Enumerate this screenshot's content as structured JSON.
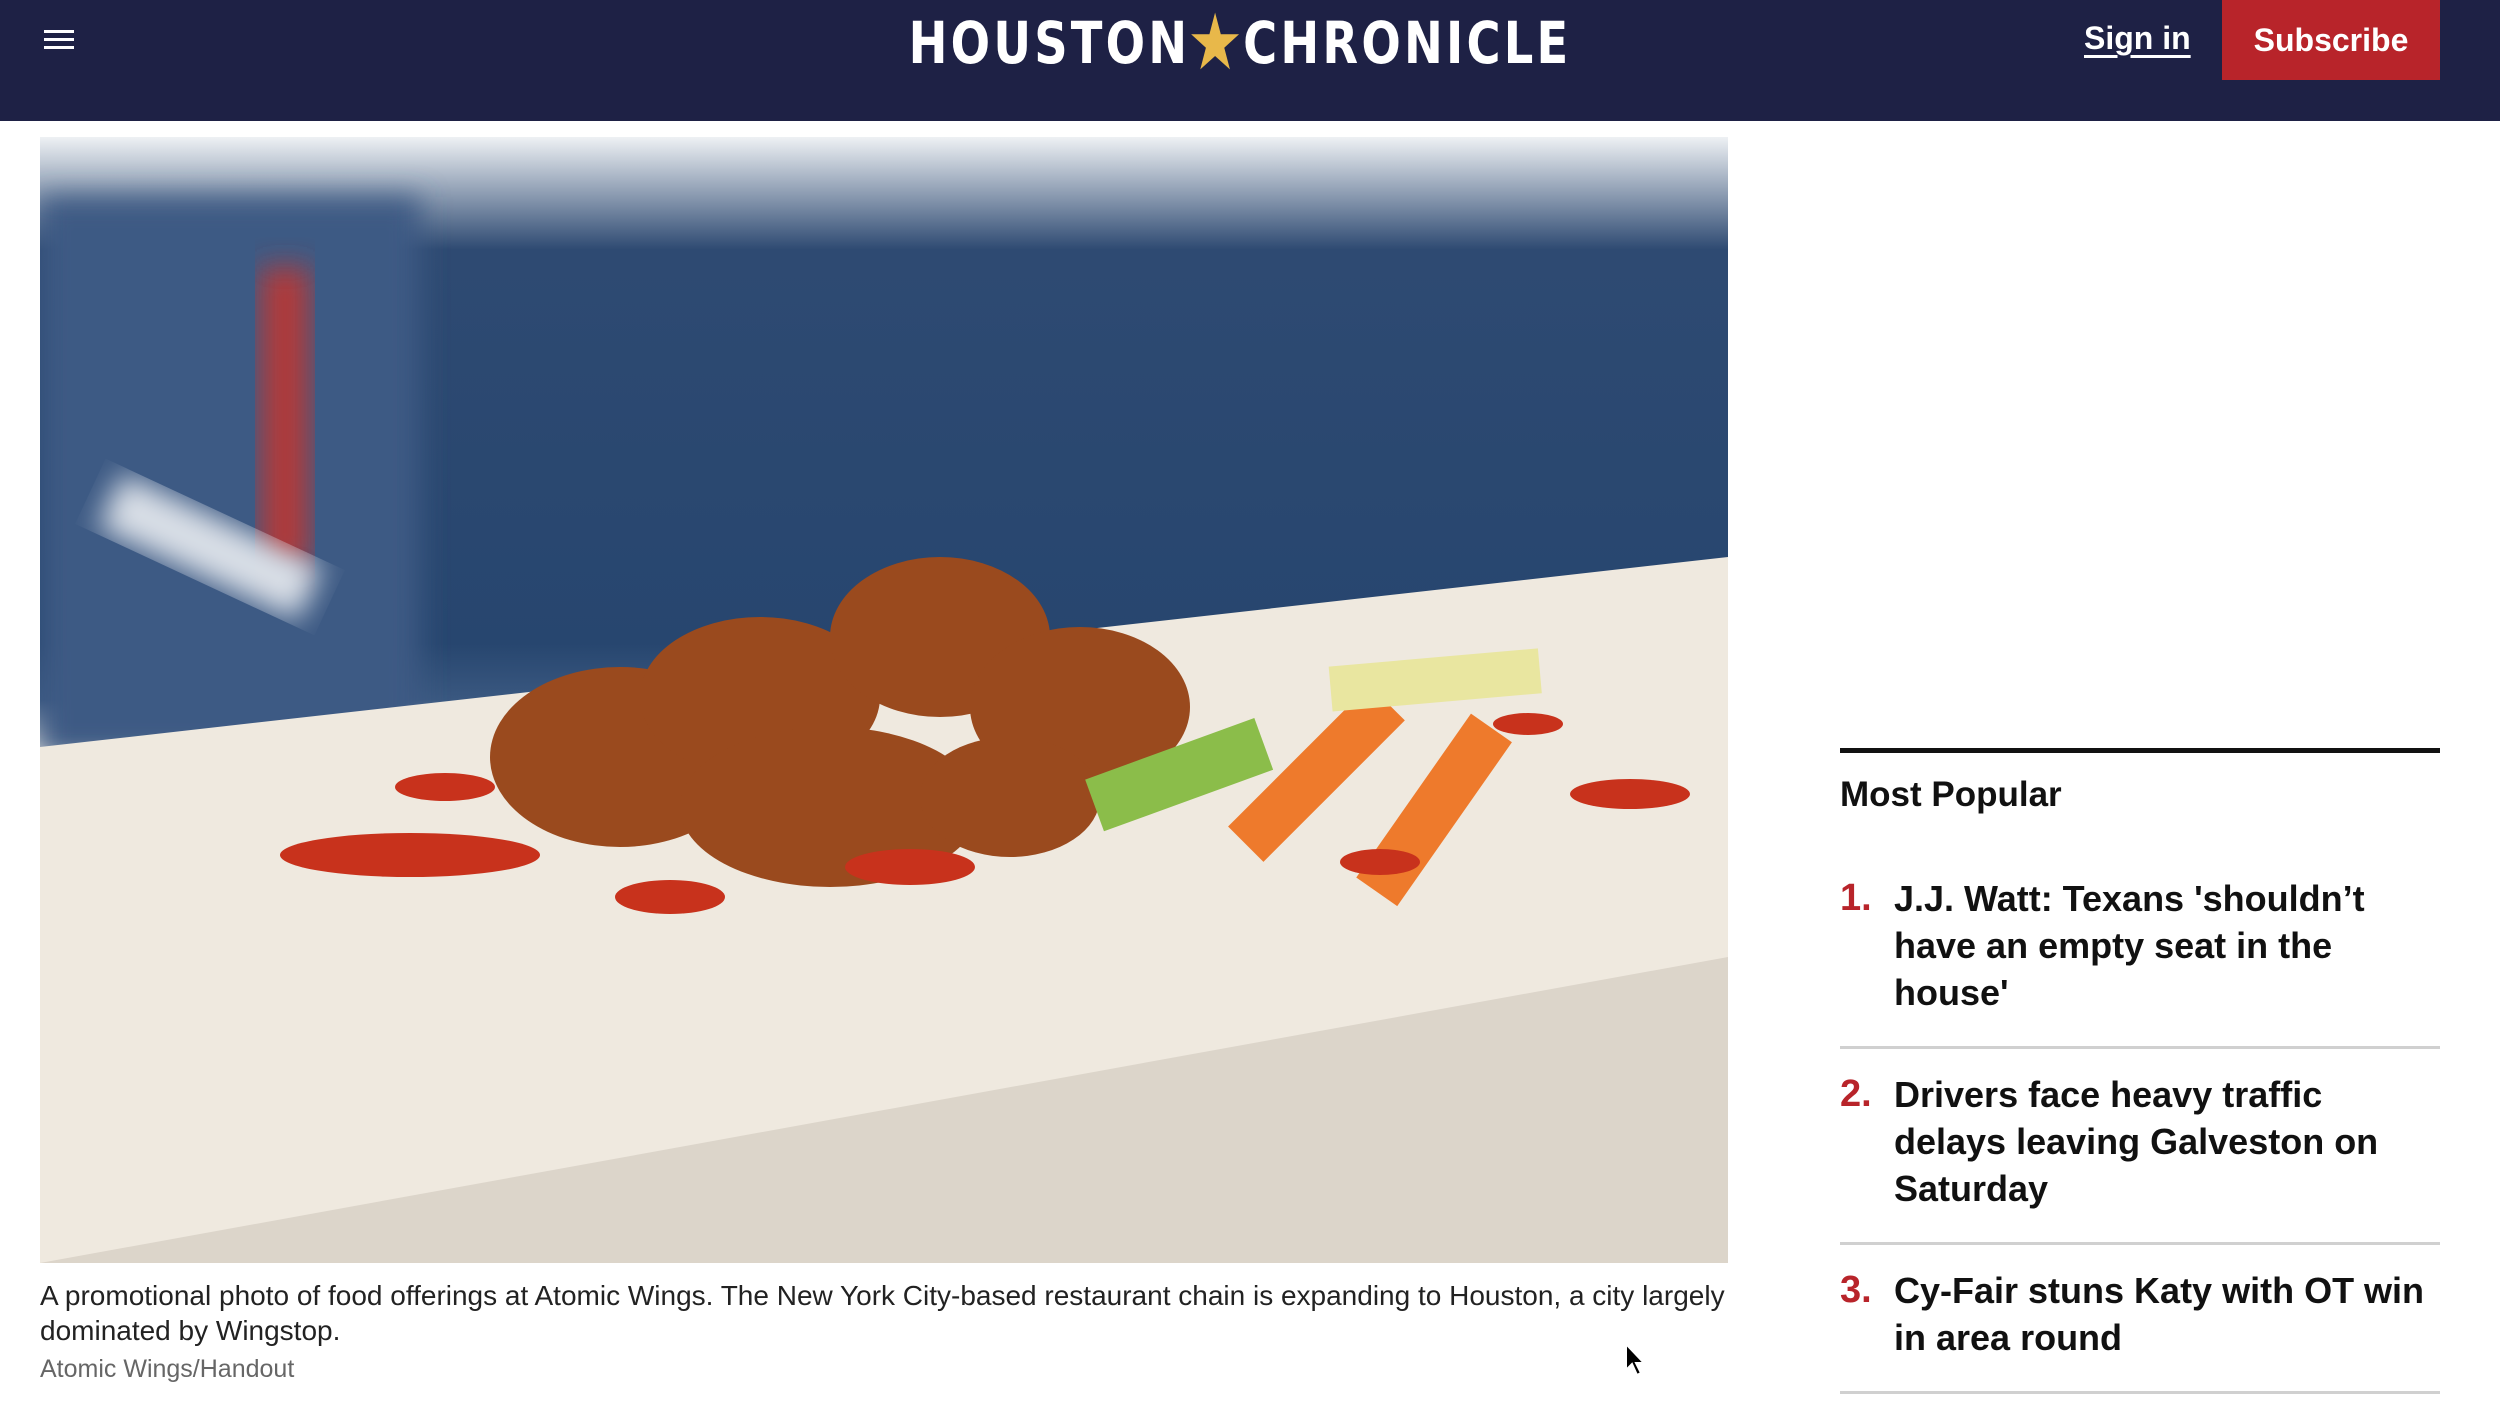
{
  "header": {
    "logo_text_left": "HOUSTON",
    "logo_text_right": "CHRONICLE",
    "sign_in": "Sign in",
    "subscribe": "Subscribe",
    "menu_icon": "hamburger-icon"
  },
  "colors": {
    "header_bg": "#1e2145",
    "accent_red": "#b8242a",
    "star_gold": "#e8b84a"
  },
  "article": {
    "caption": "A promotional photo of food offerings at Atomic Wings. The New York City-based restaurant chain is expanding to Houston, a city largely dominated by Wingstop.",
    "credit": "Atomic Wings/Handout"
  },
  "most_popular": {
    "heading": "Most Popular",
    "items": [
      {
        "num": "1.",
        "title": "J.J. Watt: Texans 'shouldn’t have an empty seat in the house'"
      },
      {
        "num": "2.",
        "title": "Drivers face heavy traffic delays leaving Galveston on Saturday"
      },
      {
        "num": "3.",
        "title": "Cy-Fair stuns Katy with OT win in area round"
      }
    ]
  }
}
